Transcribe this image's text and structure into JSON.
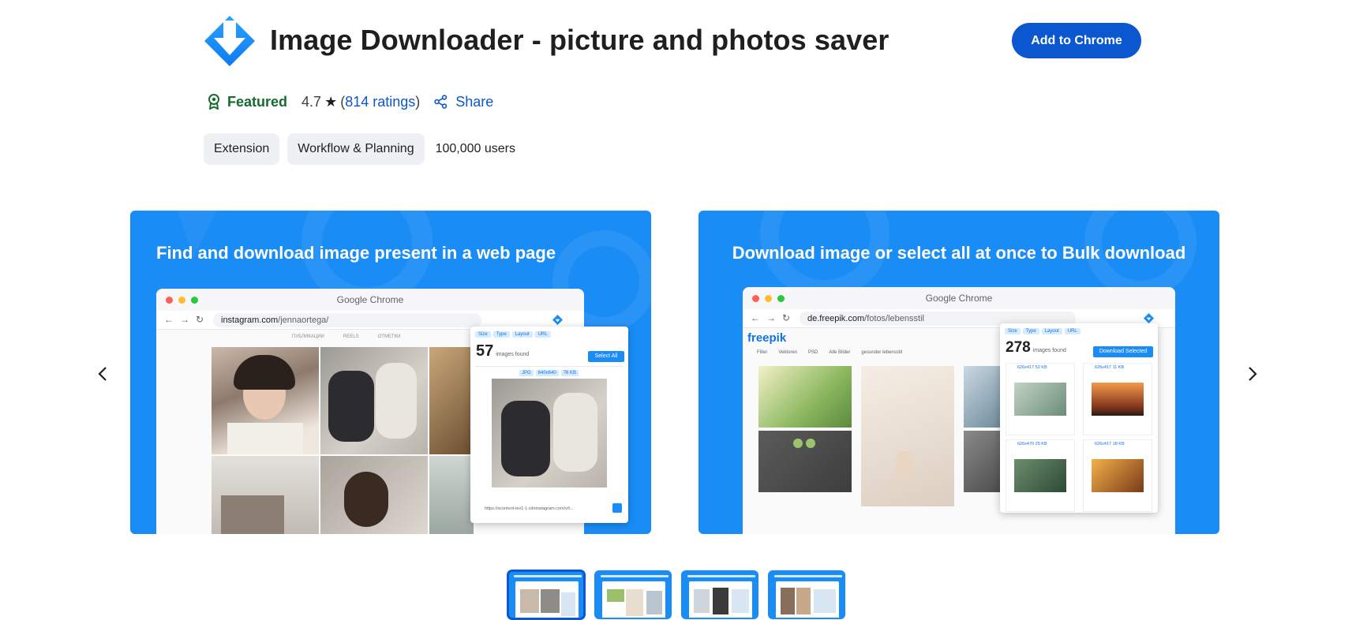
{
  "extension": {
    "title": "Image Downloader - picture and photos saver",
    "add_button": "Add to Chrome",
    "featured": "Featured",
    "rating": "4.7",
    "ratings_open": "(",
    "ratings_link": "814 ratings",
    "ratings_close": ")",
    "share": "Share",
    "chips": [
      "Extension",
      "Workflow & Planning"
    ],
    "users": "100,000 users"
  },
  "icons": {
    "logo": "download-arrow-icon",
    "featured": "featured-badge-icon",
    "star": "star-icon",
    "share": "share-icon",
    "prev": "chevron-left-icon",
    "next": "chevron-right-icon"
  },
  "slides": [
    {
      "heading": "Find and download image present in a web page",
      "browser_title": "Google Chrome",
      "url_host": "instagram.com",
      "url_path": "/jennaortega/",
      "tabs": [
        "ПУБЛИКАЦИИ",
        "REELS",
        "ОТМЕТКИ"
      ],
      "filters": [
        "Size",
        "Type",
        "Layout",
        "URL"
      ],
      "count": "57",
      "count_label": "images found",
      "select_all": "Select All",
      "image_meta": [
        "JPG",
        "640x640",
        "76 KB"
      ],
      "image_url": "https://scontent-iev1-1.cdninstagram.com/v/t..."
    },
    {
      "heading": "Download image or select all at once to Bulk download",
      "browser_title": "Google Chrome",
      "url_host": "de.freepik.com",
      "url_path": "/fotos/lebensstil",
      "site_logo": "freepik",
      "toolbar": [
        "Filter",
        "Vektoren",
        "PSD",
        "Alle Bilder",
        "gesunder lebensstil"
      ],
      "filters": [
        "Size",
        "Type",
        "Layout",
        "URL"
      ],
      "count": "278",
      "count_label": "images found",
      "download_selected": "Download Selected",
      "items": [
        {
          "dims": "626x417",
          "size": "52 KB"
        },
        {
          "dims": "626x417",
          "size": "11 KB"
        },
        {
          "dims": "626x470",
          "size": "25 KB"
        },
        {
          "dims": "626x417",
          "size": "18 KB"
        }
      ]
    }
  ],
  "colors": {
    "brand_blue": "#0b57d0",
    "slide_blue": "#1a8cf6",
    "featured_green": "#146c2e"
  }
}
